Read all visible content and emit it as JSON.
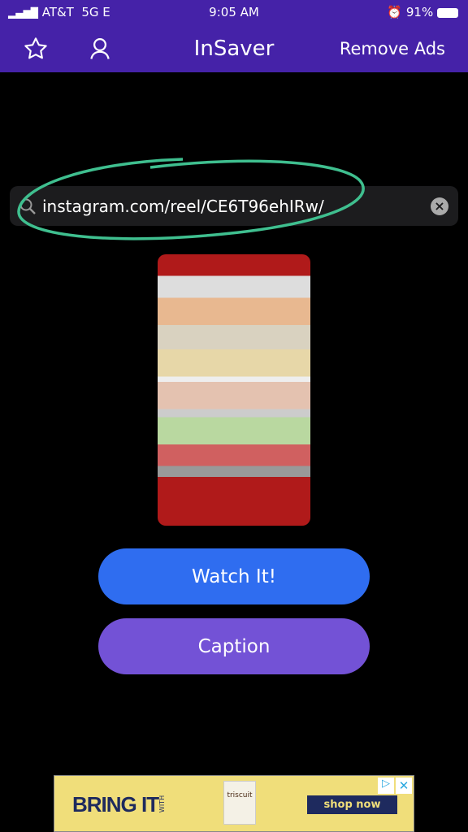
{
  "status": {
    "carrier": "AT&T",
    "network": "5G E",
    "time": "9:05 AM",
    "battery": "91%"
  },
  "header": {
    "title": "InSaver",
    "remove_ads": "Remove Ads",
    "icons": [
      "star-icon",
      "user-icon"
    ]
  },
  "search": {
    "value": "instagram.com/reel/CE6T96ehIRw/",
    "clear_icon": "x-circle-icon"
  },
  "buttons": {
    "watch": "Watch It!",
    "caption": "Caption"
  },
  "colors": {
    "header": "#4522a8",
    "watch": "#2f6df0",
    "caption": "#7352d6",
    "annotation": "#3fbf8f"
  },
  "ad": {
    "headline": "BRING IT",
    "with": "WITH",
    "brand": "triscuit",
    "cta": "shop now"
  }
}
